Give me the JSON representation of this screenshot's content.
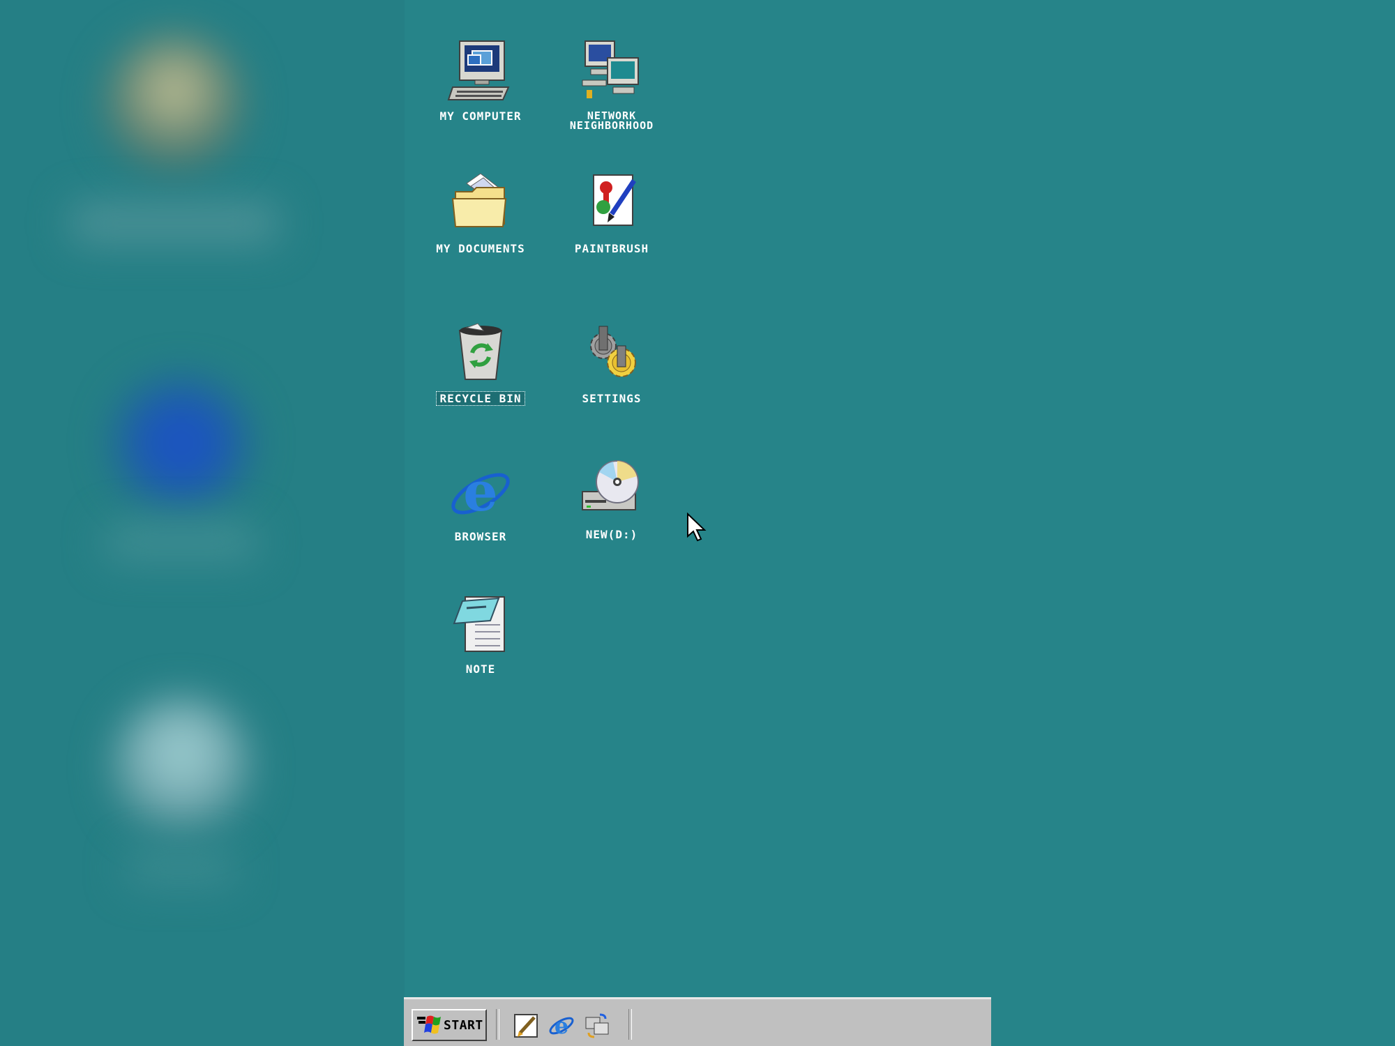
{
  "desktop": {
    "background_color": "#268489",
    "icons": [
      {
        "name": "my-computer",
        "label": "My Computer"
      },
      {
        "name": "network-neighborhood",
        "label_line1": "Network",
        "label_line2": "Neighborhood"
      },
      {
        "name": "my-documents",
        "label": "My Documents"
      },
      {
        "name": "paintbrush",
        "label": "Paintbrush"
      },
      {
        "name": "recycle-bin",
        "label": "Recycle Bin",
        "selected": true
      },
      {
        "name": "settings",
        "label": "Settings"
      },
      {
        "name": "browser",
        "label": "Browser"
      },
      {
        "name": "new-d",
        "label": "NEW(D:)"
      },
      {
        "name": "note",
        "label": "Note"
      }
    ]
  },
  "taskbar": {
    "start_label": "Start",
    "quick_launch": [
      "paintbrush-icon",
      "browser-icon",
      "swap-icon"
    ]
  }
}
